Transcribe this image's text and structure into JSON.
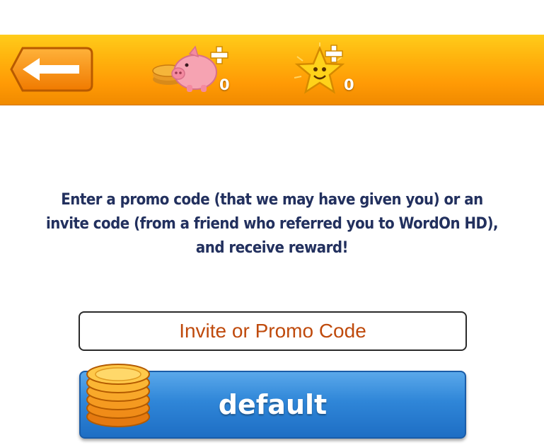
{
  "header": {
    "back_button": {
      "icon": "back-arrow-icon"
    },
    "coins": {
      "icon": "piggy-bank-plus-icon",
      "value": "0"
    },
    "stars": {
      "icon": "star-plus-icon",
      "value": "0"
    }
  },
  "main": {
    "message": "Enter a promo code (that we may have given you) or an invite code (from a friend who referred you to WordOn HD), and receive reward!",
    "input": {
      "placeholder": "Invite or Promo Code",
      "value": ""
    },
    "submit_button": {
      "label": "default",
      "icon": "coin-stack-icon"
    }
  },
  "colors": {
    "header_orange": "#ff9a05",
    "text_navy": "#22305e",
    "placeholder_orange": "#bf4a0c",
    "button_blue": "#2f86d8"
  }
}
